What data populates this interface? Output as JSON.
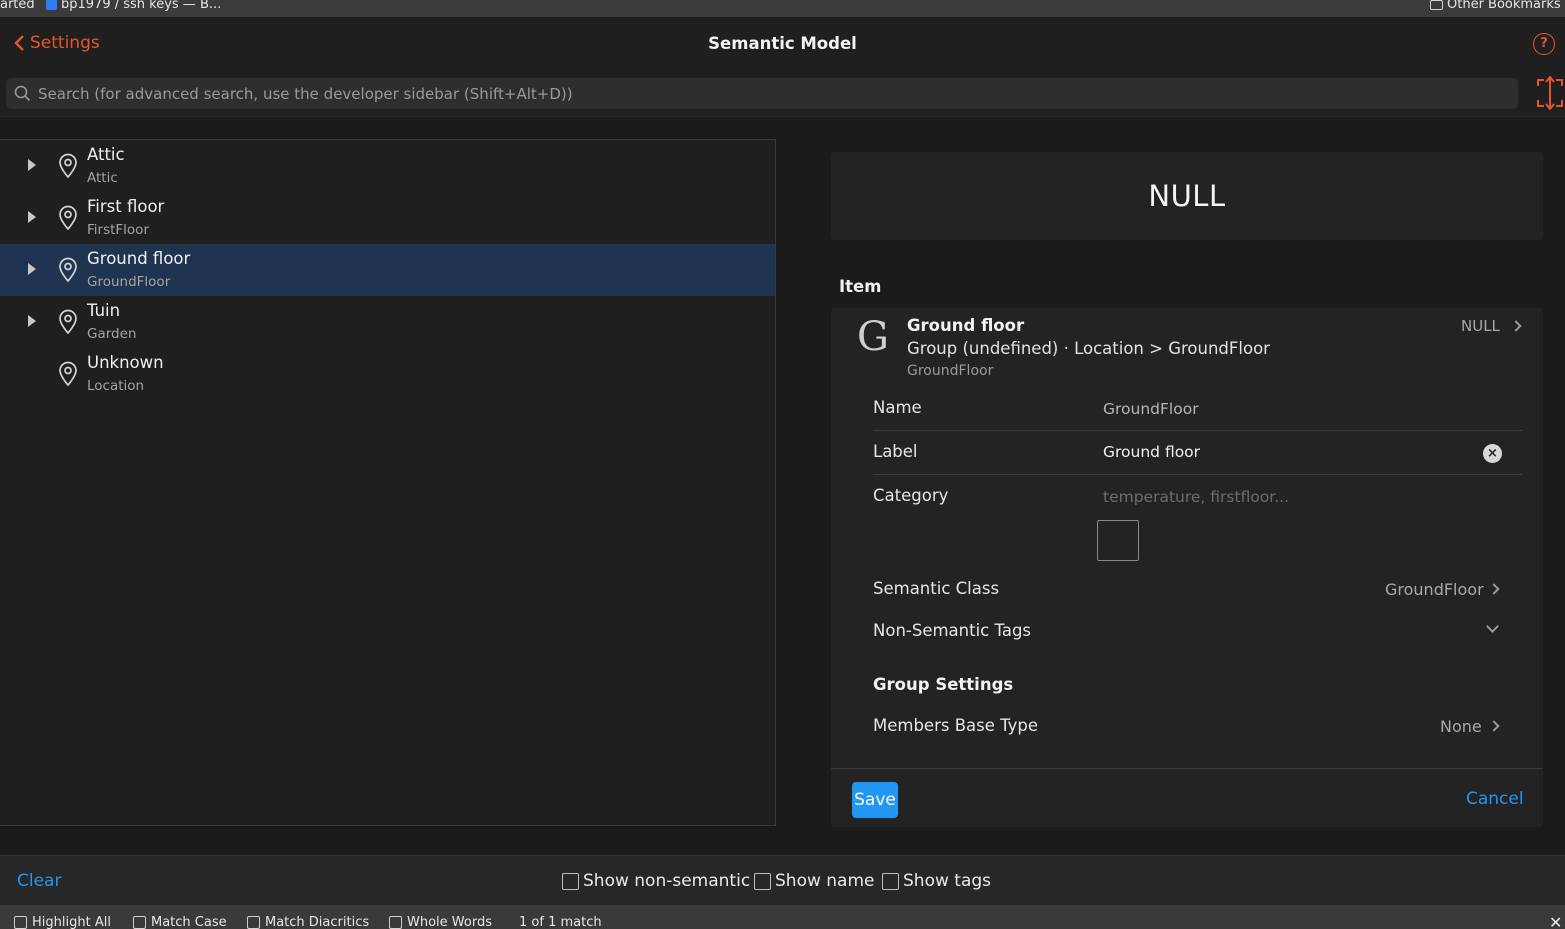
{
  "bookmarks": {
    "item1": "arted",
    "item2": "bp1979 / ssh keys — B...",
    "other": "Other Bookmarks"
  },
  "header": {
    "back_label": "Settings",
    "title": "Semantic Model",
    "search_placeholder": "Search (for advanced search, use the developer sidebar (Shift+Alt+D))"
  },
  "tree": {
    "items": [
      {
        "label": "Attic",
        "sub": "Attic",
        "expandable": true,
        "selected": false
      },
      {
        "label": "First floor",
        "sub": "FirstFloor",
        "expandable": true,
        "selected": false
      },
      {
        "label": "Ground floor",
        "sub": "GroundFloor",
        "expandable": true,
        "selected": true
      },
      {
        "label": "Tuin",
        "sub": "Garden",
        "expandable": true,
        "selected": false
      },
      {
        "label": "Unknown",
        "sub": "Location",
        "expandable": false,
        "selected": false
      }
    ]
  },
  "detail": {
    "state_card": "NULL",
    "section_title": "Item",
    "item": {
      "glyph": "G",
      "name": "Ground floor",
      "type": "Group (undefined) · Location > GroundFloor",
      "id": "GroundFloor",
      "state": "NULL"
    },
    "fields": {
      "name_label": "Name",
      "name_value": "GroundFloor",
      "label_label": "Label",
      "label_value": "Ground floor",
      "category_label": "Category",
      "category_placeholder": "temperature, firstfloor...",
      "semantic_class_label": "Semantic Class",
      "semantic_class_value": "GroundFloor",
      "nonsemantic_label": "Non-Semantic Tags"
    },
    "group_settings": {
      "title": "Group Settings",
      "members_label": "Members Base Type",
      "members_value": "None"
    },
    "save_label": "Save",
    "cancel_label": "Cancel"
  },
  "bottom": {
    "clear_label": "Clear",
    "show_nonsemantic": "Show non-semantic",
    "show_name": "Show name",
    "show_tags": "Show tags"
  },
  "findbar": {
    "highlight_all": "Highlight All",
    "match_case": "Match Case",
    "match_diacritics": "Match Diacritics",
    "whole_words": "Whole Words",
    "status": "1 of 1 match"
  },
  "colors": {
    "accent_orange": "#e4562a",
    "accent_blue": "#2196f3",
    "selected_row": "#1f3450"
  }
}
